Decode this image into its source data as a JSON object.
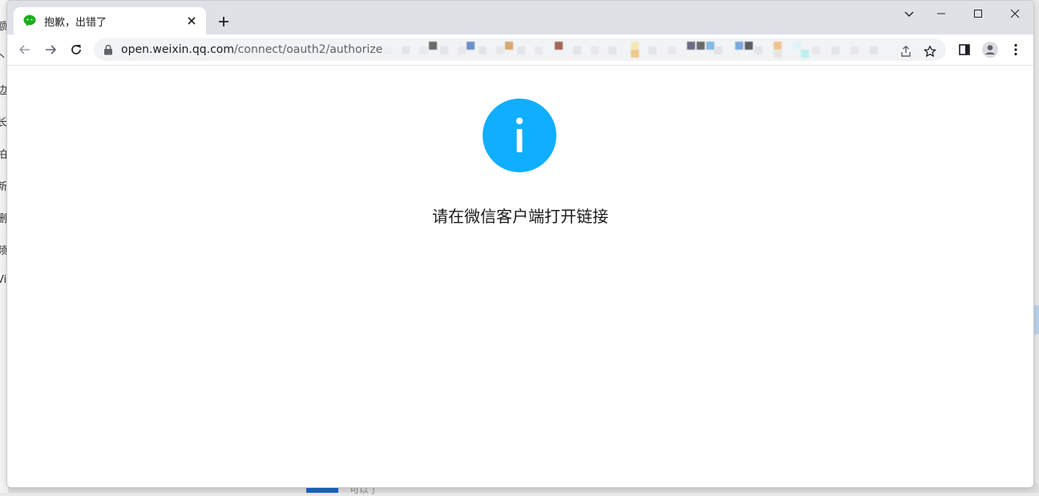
{
  "background": {
    "left_fragments": [
      "额",
      "丶",
      "边",
      "长",
      "拍",
      "新",
      "删",
      "频",
      "Vi"
    ],
    "bottom_text": "可以了"
  },
  "browser": {
    "tab": {
      "title": "抱歉，出错了",
      "favicon": "wechat-icon"
    },
    "address_bar": {
      "domain": "open.weixin.qq.com",
      "path": "/connect/oauth2/authorize"
    },
    "icons": {
      "back": "back-arrow-icon",
      "forward": "forward-arrow-icon",
      "reload": "reload-icon",
      "lock": "lock-icon",
      "share": "share-icon",
      "bookmark": "star-icon",
      "side_panel": "side-panel-icon",
      "profile": "profile-icon",
      "menu": "more-vert-icon"
    }
  },
  "page": {
    "icon": "info-icon",
    "icon_color": "#10aeff",
    "message": "请在微信客户端打开链接"
  }
}
